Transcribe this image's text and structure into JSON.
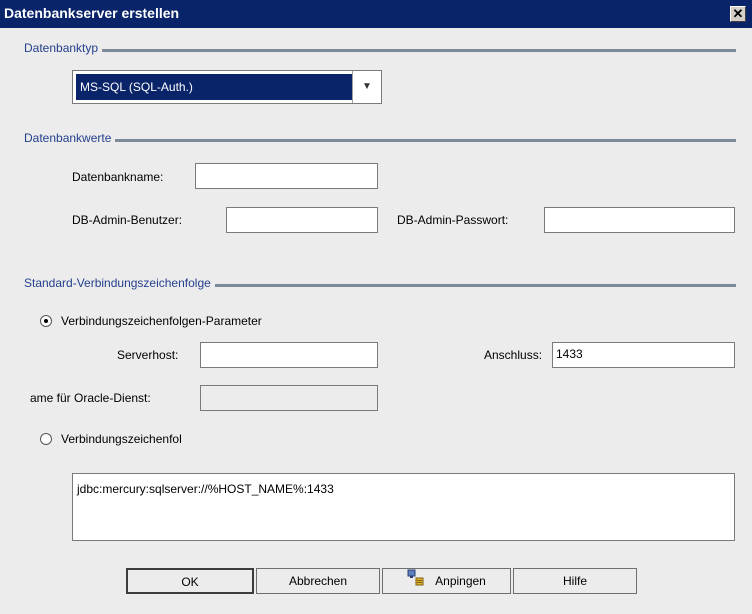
{
  "window": {
    "title": "Datenbankserver erstellen",
    "close_label": "✕"
  },
  "db_type": {
    "section_label": "Datenbanktyp",
    "selected": "MS-SQL (SQL-Auth.)"
  },
  "db_values": {
    "section_label": "Datenbankwerte",
    "db_name_label": "Datenbankname:",
    "db_name_value": "",
    "admin_user_label": "DB-Admin-Benutzer:",
    "admin_user_value": "",
    "admin_password_label": "DB-Admin-Passwort:",
    "admin_password_value": ""
  },
  "connection": {
    "section_label": "Standard-Verbindungszeichenfolge",
    "params_radio_label": "Verbindungszeichenfolgen-Parameter",
    "params_selected": true,
    "server_host_label": "Serverhost:",
    "server_host_value": "",
    "port_label": "Anschluss:",
    "port_value": "1433",
    "oracle_service_label": "ame für Oracle-Dienst:",
    "oracle_service_value": "",
    "string_radio_label": "Verbindungszeichenfol",
    "connection_string": "jdbc:mercury:sqlserver://%HOST_NAME%:1433"
  },
  "buttons": {
    "ok": "OK",
    "cancel": "Abbrechen",
    "ping": "Anpingen",
    "help": "Hilfe"
  },
  "icons": {
    "ping_icon": "ping-server-icon",
    "dropdown_icon": "chevron-down-icon"
  }
}
